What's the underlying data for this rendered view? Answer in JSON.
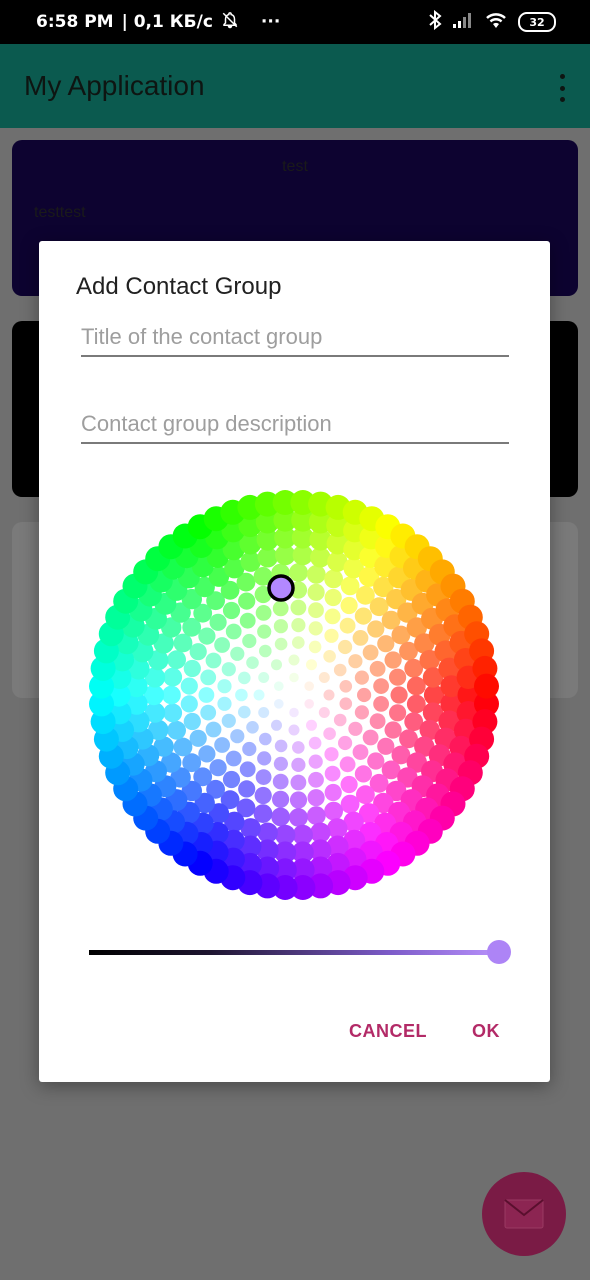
{
  "status_bar": {
    "time": "6:58 PM",
    "network": "| 0,1 КБ/с",
    "more": "···",
    "battery": "32"
  },
  "app_bar": {
    "title": "My Application",
    "menu_icon": "overflow-menu-icon"
  },
  "cards": {
    "first": {
      "title": "test",
      "description": "testtest"
    }
  },
  "dialog": {
    "title": "Add Contact Group",
    "title_field": {
      "value": "",
      "placeholder": "Title of the contact group"
    },
    "description_field": {
      "value": "",
      "placeholder": "Contact group description"
    },
    "color_picker": {
      "selected_color": "#B388FF",
      "lightness": 1.0
    },
    "cancel_label": "CANCEL",
    "ok_label": "OK"
  },
  "colors": {
    "accent": "#B32A67",
    "app_bar": "#0B5A4F",
    "card_1": "#0D0330",
    "fab": "#7A1B45"
  },
  "fab": {
    "icon": "mail-icon"
  }
}
